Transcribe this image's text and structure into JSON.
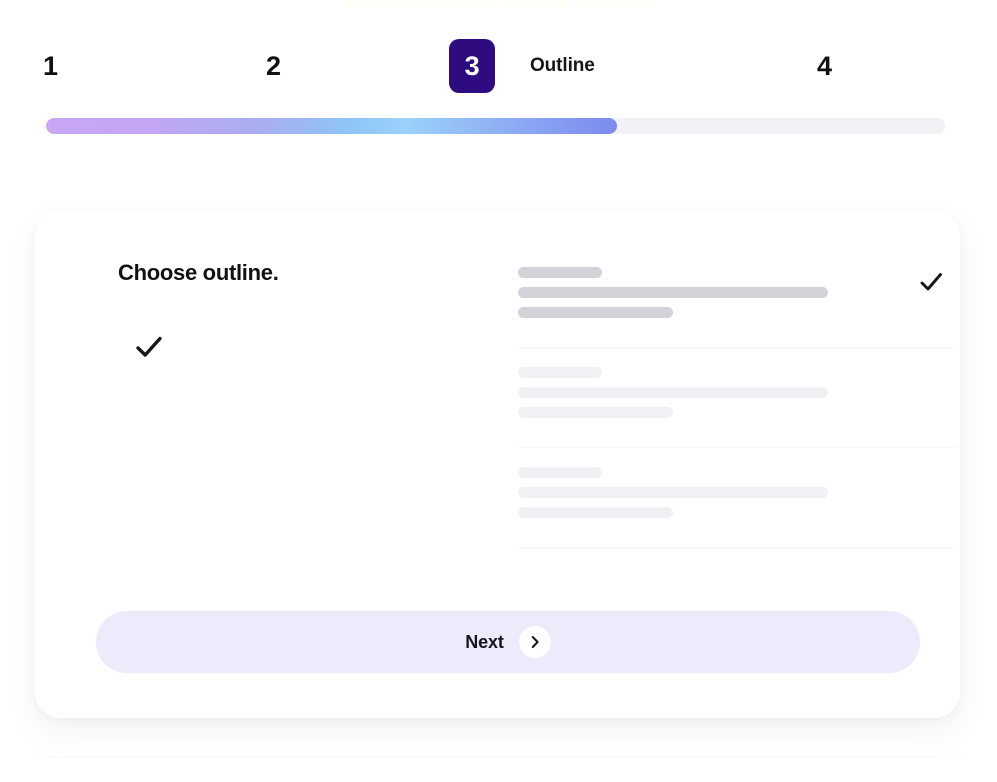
{
  "stepper": {
    "steps": [
      {
        "number": "1",
        "label": "",
        "active": false
      },
      {
        "number": "2",
        "label": "",
        "active": false
      },
      {
        "number": "3",
        "label": "Outline",
        "active": true
      },
      {
        "number": "4",
        "label": "",
        "active": false
      }
    ],
    "active_badge_color": "#2E0C80",
    "progress": {
      "percent": 63.5,
      "track_color": "#F1F1F6",
      "gradient_start": "#C9A6F6",
      "gradient_mid": "#9CD2FA",
      "gradient_end": "#7C8BEE"
    }
  },
  "card": {
    "heading": "Choose outline.",
    "selected_indicator_icon": "check-icon",
    "options": [
      {
        "selected": true,
        "check_icon": "check-icon",
        "skeleton_color": "#D2D3D9",
        "lines": [
          "short",
          "long",
          "mid"
        ]
      },
      {
        "selected": false,
        "check_icon": "",
        "skeleton_color": "#F1F1F5",
        "lines": [
          "short",
          "long",
          "mid"
        ]
      },
      {
        "selected": false,
        "check_icon": "",
        "skeleton_color": "#F1F1F5",
        "lines": [
          "short",
          "long",
          "mid"
        ]
      }
    ],
    "next_button": {
      "label": "Next",
      "icon": "chevron-right-icon",
      "background": "#ECEAFB"
    }
  }
}
